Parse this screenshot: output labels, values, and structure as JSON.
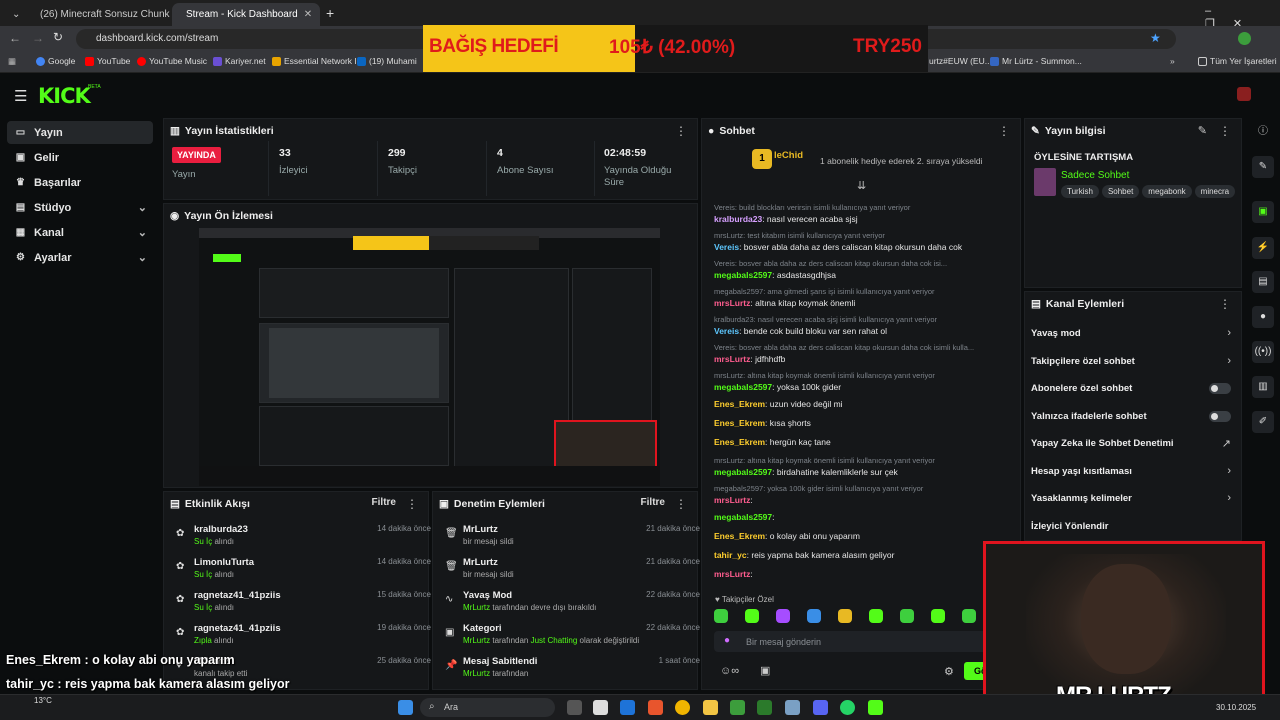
{
  "browser": {
    "tabs": [
      {
        "label": "(26) Minecraft Sonsuz Chunk D",
        "icon": "youtube-icon"
      },
      {
        "label": "Stream - Kick Dashboard",
        "icon": "kick-icon"
      }
    ],
    "url": "dashboard.kick.com/stream",
    "bookmarks": [
      "Google",
      "YouTube",
      "YouTube Music",
      "Kariyer.net",
      "Essential Network I...",
      "(19) Muhami",
      "urtz#EUW (EU...",
      "Mr Lürtz - Summon...",
      "Tüm Yer İşaretleri"
    ]
  },
  "donation": {
    "label": "BAĞIŞ HEDEFİ",
    "amount": "105₺ (42.00%)",
    "target": "TRY250",
    "progress": 0.42
  },
  "kick": {
    "logo": "KICK",
    "beta": "BETA"
  },
  "sidebar": {
    "items": [
      {
        "label": "Yayın",
        "icon": "broadcast-icon"
      },
      {
        "label": "Gelir",
        "icon": "revenue-icon"
      },
      {
        "label": "Başarılar",
        "icon": "trophy-icon"
      },
      {
        "label": "Stüdyo",
        "icon": "studio-icon"
      },
      {
        "label": "Kanal",
        "icon": "channel-icon"
      },
      {
        "label": "Ayarlar",
        "icon": "gear-icon"
      }
    ]
  },
  "stats": {
    "title": "Yayın İstatistikleri",
    "live": "YAYINDA",
    "live_label": "Yayın",
    "viewers": "33",
    "viewers_label": "İzleyici",
    "followers": "299",
    "followers_label": "Takipçi",
    "subs": "4",
    "subs_label": "Abone Sayısı",
    "duration": "02:48:59",
    "duration_label": "Yayında Olduğu Süre"
  },
  "preview": {
    "title": "Yayın Ön İzlemesi"
  },
  "activity": {
    "title": "Etkinlik Akışı",
    "filter": "Filtre",
    "rows": [
      {
        "name": "kralburda23",
        "action_a": "Su İç",
        "action_b": " alındı",
        "time": "14 dakika önce"
      },
      {
        "name": "LimonluTurta",
        "action_a": "Su İç",
        "action_b": " alındı",
        "time": "14 dakika önce"
      },
      {
        "name": "ragnetaz41_41pziis",
        "action_a": "Su İç",
        "action_b": " alındı",
        "time": "15 dakika önce"
      },
      {
        "name": "ragnetaz41_41pziis",
        "action_a": "Zıpla",
        "action_b": " alındı",
        "time": "19 dakika önce"
      },
      {
        "name": "MrLurtz",
        "action_a": "",
        "action_b": "kanalı takip etti",
        "time": "25 dakika önce"
      }
    ]
  },
  "moderation": {
    "title": "Denetim Eylemleri",
    "filter": "Filtre",
    "rows": [
      {
        "name": "MrLurtz",
        "desc": "bir mesajı sildi",
        "time": "21 dakika önce",
        "icon": "trash-icon"
      },
      {
        "name": "MrLurtz",
        "desc": "bir mesajı sildi",
        "time": "21 dakika önce",
        "icon": "trash-icon"
      },
      {
        "name": "Yavaş Mod",
        "desc_user": "MrLurtz",
        "desc": " tarafından devre dışı bırakıldı",
        "time": "22 dakika önce",
        "icon": "snail-icon"
      },
      {
        "name": "Kategori",
        "desc_user": "MrLurtz",
        "desc_mid": " tarafından ",
        "desc_hl": "Just Chatting",
        "desc": " olarak değiştirildi",
        "time": "22 dakika önce",
        "icon": "category-icon"
      },
      {
        "name": "Mesaj Sabitlendi",
        "desc_user": "MrLurtz",
        "desc": " tarafından",
        "time": "1 saat önce",
        "icon": "pin-icon"
      }
    ]
  },
  "chat": {
    "title": "Sohbet",
    "top_user": "leChid",
    "top_rank": "1",
    "top_text": "1 abonelik hediye ederek 2. sıraya yükseldi",
    "input_placeholder": "Bir mesaj gönderin",
    "followers_only": "Takipçiler Özel",
    "send": "Gön",
    "messages": [
      {
        "reply": "Vereis: build blockları verirsin isimli kullanıcıya yanıt veriyor",
        "user": "kralburda23",
        "text": ": nasıl verecen acaba sjsj",
        "c": "u5"
      },
      {
        "reply": "mrsLurtz: test kitabım isimli kullanıcıya yanıt veriyor",
        "user": "Vereis",
        "text": ": bosver abla daha az ders caliscan kitap okursun daha cok",
        "c": "u2"
      },
      {
        "reply": "Vereis: bosver abla daha az ders caliscan kitap okursun daha cok isi...",
        "user": "megabals2597",
        "text": ": asdastasgdhjsa",
        "c": "u3"
      },
      {
        "reply": "megabals2597: ama gitmedi şans işi isimli kullanıcıya yanıt veriyor",
        "user": "mrsLurtz",
        "text": ": altına kitap koymak önemli",
        "c": "u4"
      },
      {
        "reply": "kralburda23: nasıl verecen acaba sjsj isimli kullanıcıya yanıt veriyor",
        "user": "Vereis",
        "text": ": bende cok build bloku var sen rahat ol",
        "c": "u2"
      },
      {
        "reply": "Vereis: bosver abla daha az ders caliscan kitap okursun daha cok isimli kulla...",
        "user": "mrsLurtz",
        "text": ": jdfhhdfb",
        "c": "u4"
      },
      {
        "reply": "mrsLurtz: altına kitap koymak önemli isimli kullanıcıya yanıt veriyor",
        "user": "megabals2597",
        "text": ": yoksa 100k gider",
        "c": "u3"
      },
      {
        "reply": "",
        "user": "Enes_Ekrem",
        "text": ": uzun video değil mi",
        "c": "u1"
      },
      {
        "reply": "",
        "user": "Enes_Ekrem",
        "text": ": kısa şhorts",
        "c": "u1"
      },
      {
        "reply": "",
        "user": "Enes_Ekrem",
        "text": ": hergün kaç tane",
        "c": "u1"
      },
      {
        "reply": "mrsLurtz: altına kitap koymak önemli isimli kullanıcıya yanıt veriyor",
        "user": "megabals2597",
        "text": ": birdahatine kalemliklerle sur çek",
        "c": "u3"
      },
      {
        "reply": "megabals2597: yoksa 100k gider isimli kullanıcıya yanıt veriyor",
        "user": "mrsLurtz",
        "text": ":",
        "c": "u4"
      },
      {
        "reply": "",
        "user": "megabals2597",
        "text": ":",
        "c": "u3"
      },
      {
        "reply": "",
        "user": "Enes_Ekrem",
        "text": ": o kolay abi onu yaparım",
        "c": "u1"
      },
      {
        "reply": "",
        "user": "tahir_yc",
        "text": ": reis yapma bak kamera alasım geliyor",
        "c": "u1"
      },
      {
        "reply": "",
        "user": "mrsLurtz",
        "text": ":",
        "c": "u4"
      }
    ]
  },
  "info": {
    "title": "Yayın bilgisi",
    "stream_title": "ÖYLESİNE TARTIŞMA",
    "category": "Sadece Sohbet",
    "tags": [
      "Turkish",
      "Sohbet",
      "megabonk",
      "minecra"
    ]
  },
  "channel_actions": {
    "title": "Kanal Eylemleri",
    "items": [
      {
        "label": "Yavaş mod",
        "kind": "arrow"
      },
      {
        "label": "Takipçilere özel sohbet",
        "kind": "arrow"
      },
      {
        "label": "Abonelere özel sohbet",
        "kind": "toggle"
      },
      {
        "label": "Yalnızca ifadelerle sohbet",
        "kind": "toggle"
      },
      {
        "label": "Yapay Zeka ile Sohbet Denetimi",
        "kind": "external"
      },
      {
        "label": "Hesap yaşı kısıtlaması",
        "kind": "arrow"
      },
      {
        "label": "Yasaklanmış kelimeler",
        "kind": "arrow"
      },
      {
        "label": "İzleyici Yönlendir",
        "kind": "none"
      }
    ]
  },
  "overlay": {
    "chat_lines": [
      {
        "user": "Enes_Ekrem",
        "text": " : o kolay abi onu yaparım"
      },
      {
        "user": "tahir_yc",
        "text": " : reis yapma bak kamera alasım geliyor"
      }
    ],
    "cam_name": "MR LURTZ"
  },
  "taskbar": {
    "search": "Ara",
    "temp": "13°C",
    "date": "30.10.2025"
  }
}
